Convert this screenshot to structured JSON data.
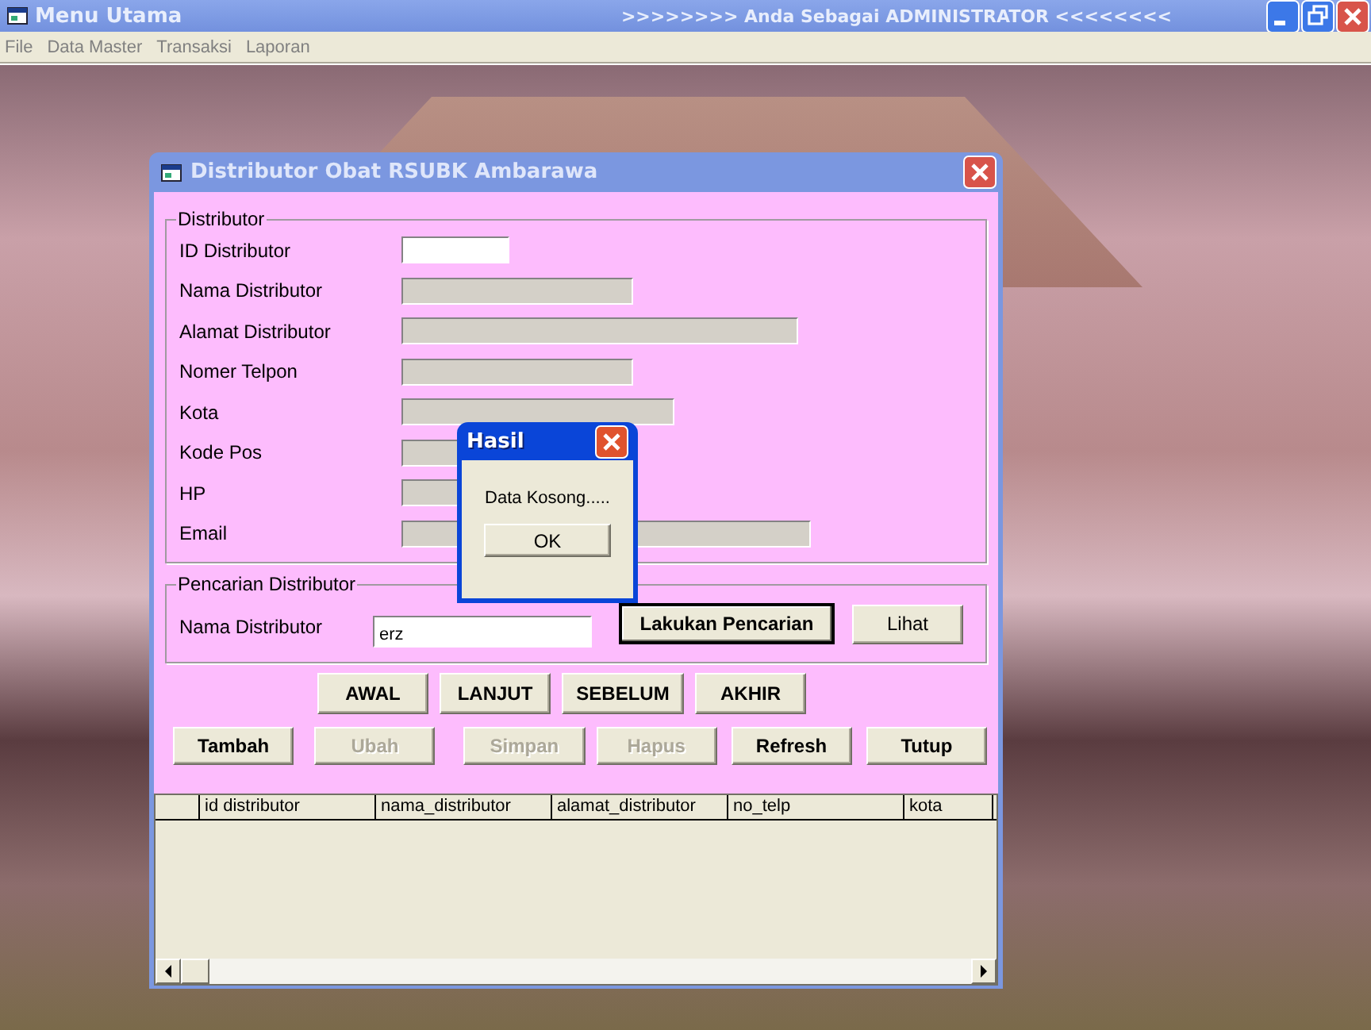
{
  "window": {
    "title": "Menu Utama",
    "banner": ">>>>>>>> Anda Sebagai ADMINISTRATOR <<<<<<<<"
  },
  "menu": [
    "File",
    "Data Master",
    "Transaksi",
    "Laporan"
  ],
  "dialog": {
    "title": "Distributor Obat RSUBK Ambarawa",
    "distributor_group": {
      "title": "Distributor",
      "fields": [
        {
          "label": "ID Distributor",
          "disabled": false
        },
        {
          "label": "Nama Distributor",
          "disabled": true
        },
        {
          "label": "Alamat Distributor",
          "disabled": true
        },
        {
          "label": "Nomer Telpon",
          "disabled": true
        },
        {
          "label": "Kota",
          "disabled": true
        },
        {
          "label": "Kode Pos",
          "disabled": true
        },
        {
          "label": "HP",
          "disabled": true
        },
        {
          "label": "Email",
          "disabled": true
        }
      ]
    },
    "search_group": {
      "title": "Pencarian Distributor",
      "label": "Nama Distributor",
      "value": "erz",
      "buttons": [
        {
          "label": "Lakukan Pencarian",
          "default": true
        },
        {
          "label": "Lihat",
          "default": false
        }
      ]
    },
    "nav_buttons": [
      "AWAL",
      "LANJUT",
      "SEBELUM",
      "AKHIR"
    ],
    "action_buttons": [
      {
        "label": "Tambah",
        "disabled": false
      },
      {
        "label": "Ubah",
        "disabled": true
      },
      {
        "label": "Simpan",
        "disabled": true
      },
      {
        "label": "Hapus",
        "disabled": true
      },
      {
        "label": "Refresh",
        "disabled": false
      },
      {
        "label": "Tutup",
        "disabled": false
      }
    ],
    "grid": {
      "columns": [
        "id distributor",
        "nama_distributor",
        "alamat_distributor",
        "no_telp",
        "kota"
      ]
    }
  },
  "message_box": {
    "title": "Hasil",
    "text": "Data Kosong.....",
    "button": "OK"
  }
}
